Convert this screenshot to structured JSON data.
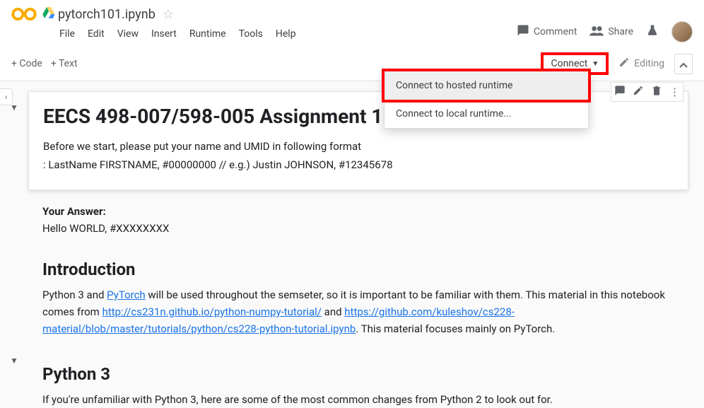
{
  "header": {
    "title": "pytorch101.ipynb",
    "comment": "Comment",
    "share": "Share"
  },
  "menus": {
    "file": "File",
    "edit": "Edit",
    "view": "View",
    "insert": "Insert",
    "runtime": "Runtime",
    "tools": "Tools",
    "help": "Help"
  },
  "secondbar": {
    "code": "+ Code",
    "text": "+ Text",
    "connect": "Connect",
    "editing": "Editing"
  },
  "dropdown": {
    "hosted": "Connect to hosted runtime",
    "local": "Connect to local runtime..."
  },
  "doc": {
    "title": "EECS 498-007/598-005 Assignment 1-",
    "intro1": "Before we start, please put your name and UMID in following format",
    "intro2": ": LastName FIRSTNAME, #00000000 // e.g.) Justin JOHNSON, #12345678",
    "your_answer_label": "Your Answer:",
    "your_answer_value": "Hello WORLD, #XXXXXXXX",
    "introduction_heading": "Introduction",
    "intro_para_pre": "Python 3 and ",
    "intro_pytorch": "PyTorch",
    "intro_para_mid": " will be used throughout the semseter, so it is important to be familiar with them. This material in this notebook comes from ",
    "link1": "http://cs231n.github.io/python-numpy-tutorial/",
    "intro_and": " and ",
    "link2": "https://github.com/kuleshov/cs228-material/blob/master/tutorials/python/cs228-python-tutorial.ipynb",
    "intro_para_end": ". This material focuses mainly on PyTorch.",
    "python3_heading": "Python 3",
    "python3_text": "If you're unfamiliar with Python 3, here are some of the most common changes from Python 2 to look out for."
  }
}
